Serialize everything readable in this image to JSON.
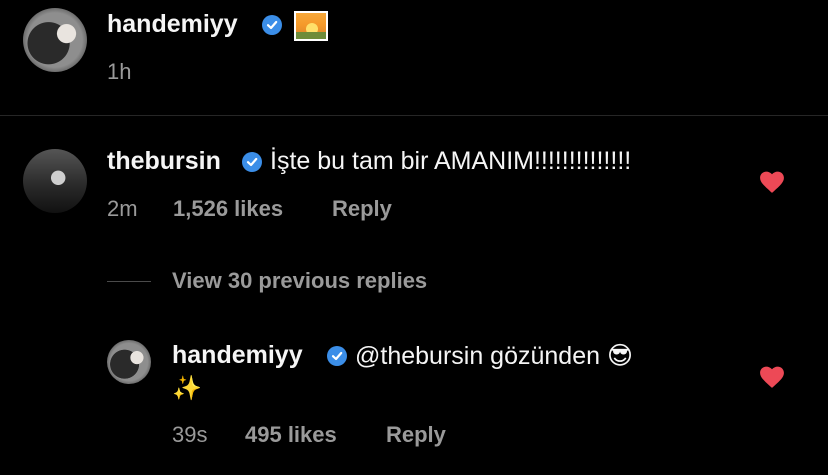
{
  "post": {
    "username": "handemiyy",
    "emoji": "🌅",
    "time": "1h"
  },
  "comment": {
    "username": "thebursin",
    "text": "İşte bu tam bir AMANIM!!!!!!!!!!!!!!",
    "time": "2m",
    "likes": "1,526 likes",
    "reply_label": "Reply"
  },
  "view_replies": "View 30 previous replies",
  "reply": {
    "username": "handemiyy",
    "text": "@thebursin gözünden 😎",
    "emoji_line": "✨",
    "time": "39s",
    "likes": "495 likes",
    "reply_label": "Reply"
  },
  "colors": {
    "background": "#000000",
    "verified": "#3b8ee8",
    "heart": "#ed4956",
    "meta": "#9a9a9a"
  }
}
